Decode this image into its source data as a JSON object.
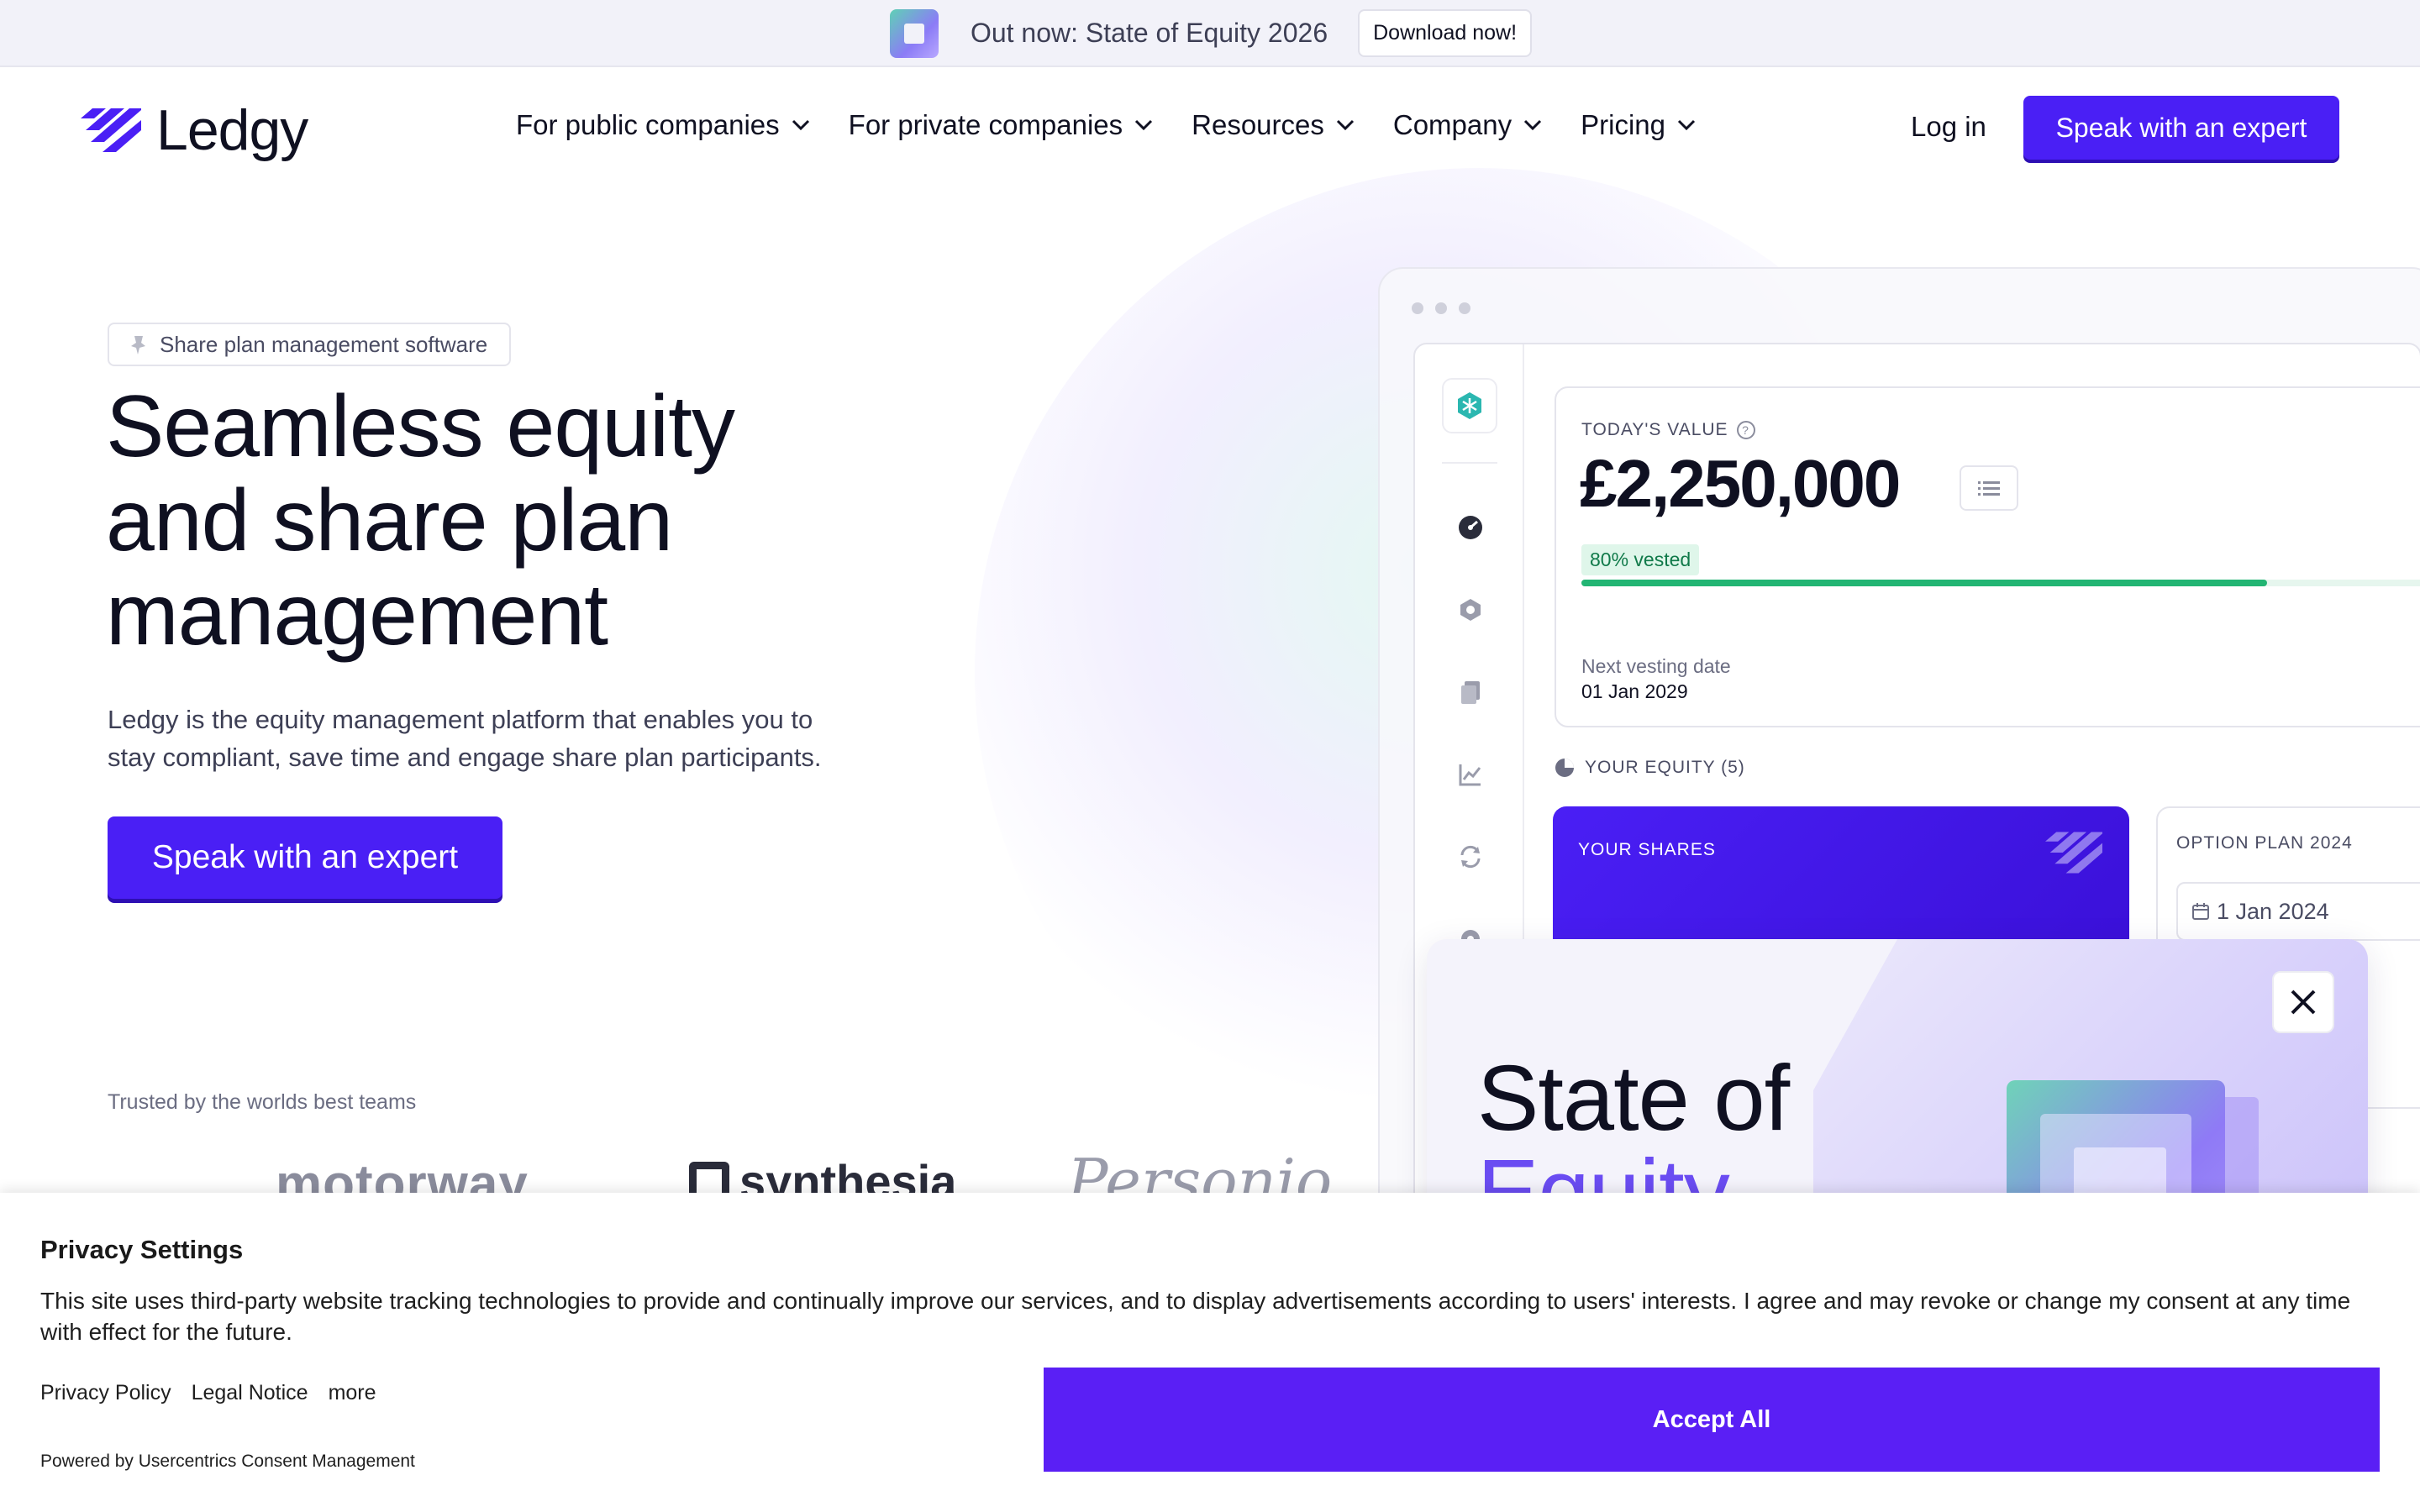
{
  "announcement": {
    "text": "Out now: State of Equity 2026",
    "button": "Download now!"
  },
  "nav": {
    "brand": "Ledgy",
    "links": [
      {
        "label": "For public companies"
      },
      {
        "label": "For private companies"
      },
      {
        "label": "Resources"
      },
      {
        "label": "Company"
      },
      {
        "label": "Pricing"
      }
    ],
    "login": "Log in",
    "cta": "Speak with an expert"
  },
  "hero": {
    "pill": "Share plan management software",
    "title": "Seamless equity and share plan management",
    "subtitle": "Ledgy is the equity management platform that enables you to stay compliant, save time and engage share plan participants.",
    "cta": "Speak with an expert",
    "trusted": "Trusted by the worlds best teams",
    "logos": [
      "motorway",
      "synthesia",
      "Personio"
    ]
  },
  "app_mockup": {
    "sidebar_icons": [
      "dashboard-icon",
      "cube-icon",
      "documents-icon",
      "chart-icon",
      "refresh-icon",
      "settings-icon"
    ],
    "value_card": {
      "label": "TODAY'S VALUE",
      "value": "£2,250,000",
      "vested_badge": "80% vested",
      "vested_fraction": 0.8,
      "next_vesting_label": "Next vesting date",
      "next_vesting_value": "01 Jan 2029"
    },
    "equity_label": "YOUR EQUITY (5)",
    "shares_card_label": "YOUR SHARES",
    "option_card": {
      "label": "OPTION PLAN 2024",
      "date": "1 Jan 2024"
    }
  },
  "promo": {
    "title_line1": "State of",
    "title_line2": "Equity"
  },
  "cookie": {
    "title": "Privacy Settings",
    "body": "This site uses third-party website tracking technologies to provide and continually improve our services, and to display advertisements according to users' interests. I agree and may revoke or change my consent at any time with effect for the future.",
    "links": [
      "Privacy Policy",
      "Legal Notice",
      "more"
    ],
    "powered_by": "Powered by Usercentrics Consent Management",
    "accept": "Accept All"
  },
  "colors": {
    "brand_purple": "#4a1ff5",
    "accept_purple": "#5a1ff5",
    "vested_green": "#22b573",
    "text_dark": "#0f1021"
  }
}
